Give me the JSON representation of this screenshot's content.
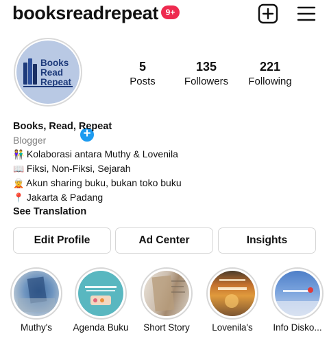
{
  "header": {
    "username": "booksreadrepeat",
    "notification_count": "9+"
  },
  "profile": {
    "avatar_text": [
      "Books",
      "Read",
      "Repeat"
    ],
    "stats": [
      {
        "value": "5",
        "label": "Posts"
      },
      {
        "value": "135",
        "label": "Followers"
      },
      {
        "value": "221",
        "label": "Following"
      }
    ]
  },
  "bio": {
    "name": "Books, Read, Repeat",
    "category": "Blogger",
    "lines": [
      {
        "icon": "👫",
        "text": "Kolaborasi antara Muthy & Lovenila"
      },
      {
        "icon": "📖",
        "text": "Fiksi, Non-Fiksi, Sejarah"
      },
      {
        "icon": "🧝",
        "text": "Akun sharing buku, bukan toko buku"
      },
      {
        "icon": "📍",
        "text": "Jakarta & Padang"
      }
    ],
    "see_translation": "See Translation"
  },
  "actions": {
    "edit_profile": "Edit Profile",
    "ad_center": "Ad Center",
    "insights": "Insights"
  },
  "highlights": [
    {
      "label": "Muthy's"
    },
    {
      "label": "Agenda Buku"
    },
    {
      "label": "Short Story"
    },
    {
      "label": "Lovenila's"
    },
    {
      "label": "Info Disko..."
    }
  ],
  "colors": {
    "badge": "#ee2a4f",
    "add_story": "#1d9bf0",
    "avatar_bg": "#b9c9e4",
    "avatar_text": "#1d3a7a"
  }
}
